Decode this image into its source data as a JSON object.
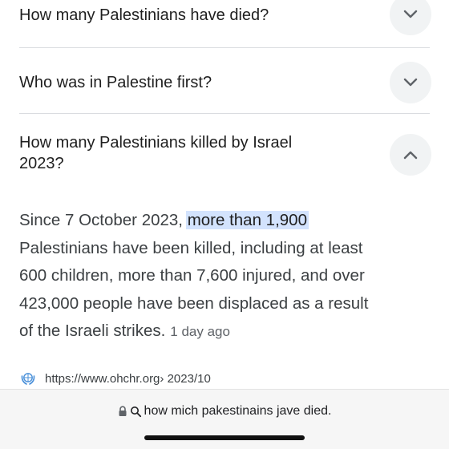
{
  "faq": {
    "items": [
      {
        "question": "How many Palestinians have died?",
        "expanded": false,
        "chevron": "chevron-down-icon"
      },
      {
        "question": "Who was in Palestine first?",
        "expanded": false,
        "chevron": "chevron-down-icon"
      },
      {
        "question_line1": "How many Palestinians killed by Israel",
        "question_line2": "2023?",
        "expanded": true,
        "chevron": "chevron-up-icon"
      }
    ]
  },
  "answer": {
    "prefix": "Since 7 October 2023, ",
    "highlight": "more than 1,900",
    "line2": "Palestinians have been killed, including at least",
    "line3": "600 children, more than 7,600 injured, and over",
    "line4": "423,000 people have been displaced as a result",
    "line5": "of the Israeli strikes.",
    "date": "1 day ago"
  },
  "source": {
    "url": "https://www.ohchr.org",
    "path": " › 2023/10",
    "favicon": "un-emblem-icon"
  },
  "browser": {
    "address_text": "how mich pakestinains jave died.",
    "lock_icon": "lock-icon",
    "search_icon": "search-icon"
  },
  "colors": {
    "highlight": "#d3e3fd",
    "chevron_bg": "#f1f3f4",
    "favicon": "#4a90d9"
  }
}
